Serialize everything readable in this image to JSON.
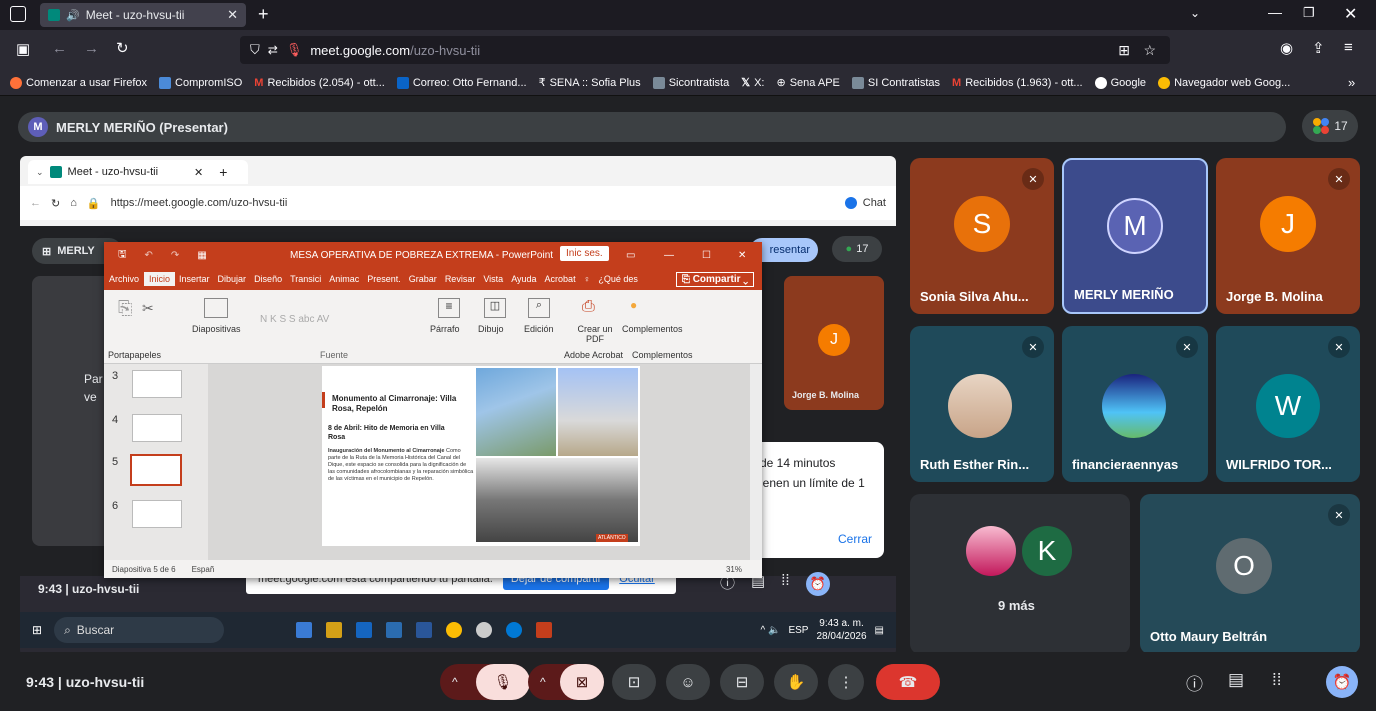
{
  "browser": {
    "tab_title": "Meet - uzo-hvsu-tii",
    "url_domain": "meet.google.com",
    "url_path": "/uzo-hvsu-tii",
    "bookmarks": [
      "Comenzar a usar Firefox",
      "CompromISO",
      "Recibidos (2.054) - ott...",
      "Correo: Otto Fernand...",
      "SENA :: Sofia Plus",
      "Sicontratista",
      "X:",
      "Sena APE",
      "SI Contratistas",
      "Recibidos (1.963) - ott...",
      "Google",
      "Navegador web Goog..."
    ]
  },
  "meet": {
    "presenter_label": "MERLY MERIÑO (Presentar)",
    "presenter_initial": "M",
    "participant_count": "17",
    "time": "9:43",
    "meeting_code": "uzo-hvsu-tii",
    "tiles": [
      {
        "name": "Sonia Silva Ahu...",
        "initial": "S",
        "color": "#e8710a",
        "bg": "#8c3a1e"
      },
      {
        "name": "MERLY MERIÑO",
        "initial": "M",
        "color": "#5a63b3",
        "bg": "#3c4b8c"
      },
      {
        "name": "Jorge B. Molina",
        "initial": "J",
        "color": "#f57c00",
        "bg": "#8c3a1e"
      },
      {
        "name": "Ruth Esther Rin...",
        "initial": "",
        "color": "#ffffff",
        "bg": "#1f4a5a"
      },
      {
        "name": "financieraennyas",
        "initial": "",
        "color": "#ffffff",
        "bg": "#1f4a5a"
      },
      {
        "name": "WILFRIDO TOR...",
        "initial": "W",
        "color": "#00838f",
        "bg": "#1f4a5a"
      },
      {
        "name": "9 más",
        "initial": "K",
        "color": "#1e6b43",
        "bg": "#2d3035"
      },
      {
        "name": "Otto Maury Beltrán",
        "initial": "O",
        "color": "#5f6b70",
        "bg": "#254a58"
      }
    ]
  },
  "shared": {
    "inner_tab": "Meet - uzo-hvsu-tii",
    "inner_url": "https://meet.google.com/uzo-hvsu-tii",
    "inner_chat": "Chat",
    "inner_presenter": "MERLY",
    "inner_present_btn": "resentar",
    "inner_count": "17",
    "inner_jorge": "Jorge B. Molina",
    "inner_time": "9:43  |  uzo-hvsu-tii",
    "dialog_line1": "de 14 minutos",
    "dialog_line2": "ienen un límite de 1",
    "dialog_close": "Cerrar",
    "share_notice": "meet.google.com está compartiendo tu pantalla.",
    "stop_share": "Dejar de compartir",
    "hide": "Ocultar",
    "taskbar_search": "Buscar",
    "taskbar_lang": "ESP",
    "taskbar_time": "9:43 a. m.",
    "taskbar_date": "28/04/2026",
    "partial_text": "Par",
    "partial_text2": "ve"
  },
  "ppt": {
    "title": "MESA OPERATIVA DE POBREZA EXTREMA - PowerPoint",
    "signin": "Inic ses.",
    "menu": [
      "Archivo",
      "Inicio",
      "Insertar",
      "Dibujar",
      "Diseño",
      "Transici",
      "Animac",
      "Present.",
      "Grabar",
      "Revisar",
      "Vista",
      "Ayuda",
      "Acrobat",
      "¿Qué des"
    ],
    "share": "Compartir",
    "ribbon": [
      "Diapositivas",
      "Párrafo",
      "Dibujo",
      "Edición",
      "Crear un PDF",
      "Complementos"
    ],
    "group_labels": [
      "Portapapeles",
      "Fuente",
      "Adobe Acrobat",
      "Complementos"
    ],
    "slide_numbers": [
      "3",
      "4",
      "5",
      "6"
    ],
    "status": "Diapositiva 5 de 6",
    "status_lang": "Españ",
    "zoom": "31%",
    "slide_title": "Monumento al Cimarronaje: Villa Rosa, Repelón",
    "slide_sub": "8 de Abril: Hito de Memoria en Villa Rosa",
    "slide_body_bold": "Inauguración del Monumento al Cimarronaje",
    "slide_body": "Como parte de la Ruta de la Memoria Histórica del Canal del Dique, este espacio se consolida para la dignificación de las comunidades afrocolombianas y la reparación simbólica de las víctimas en el municipio de Repelón.",
    "footer_label": "ATLÁNTICO"
  },
  "bottom": {
    "time": "9:43",
    "code": "uzo-hvsu-tii"
  }
}
